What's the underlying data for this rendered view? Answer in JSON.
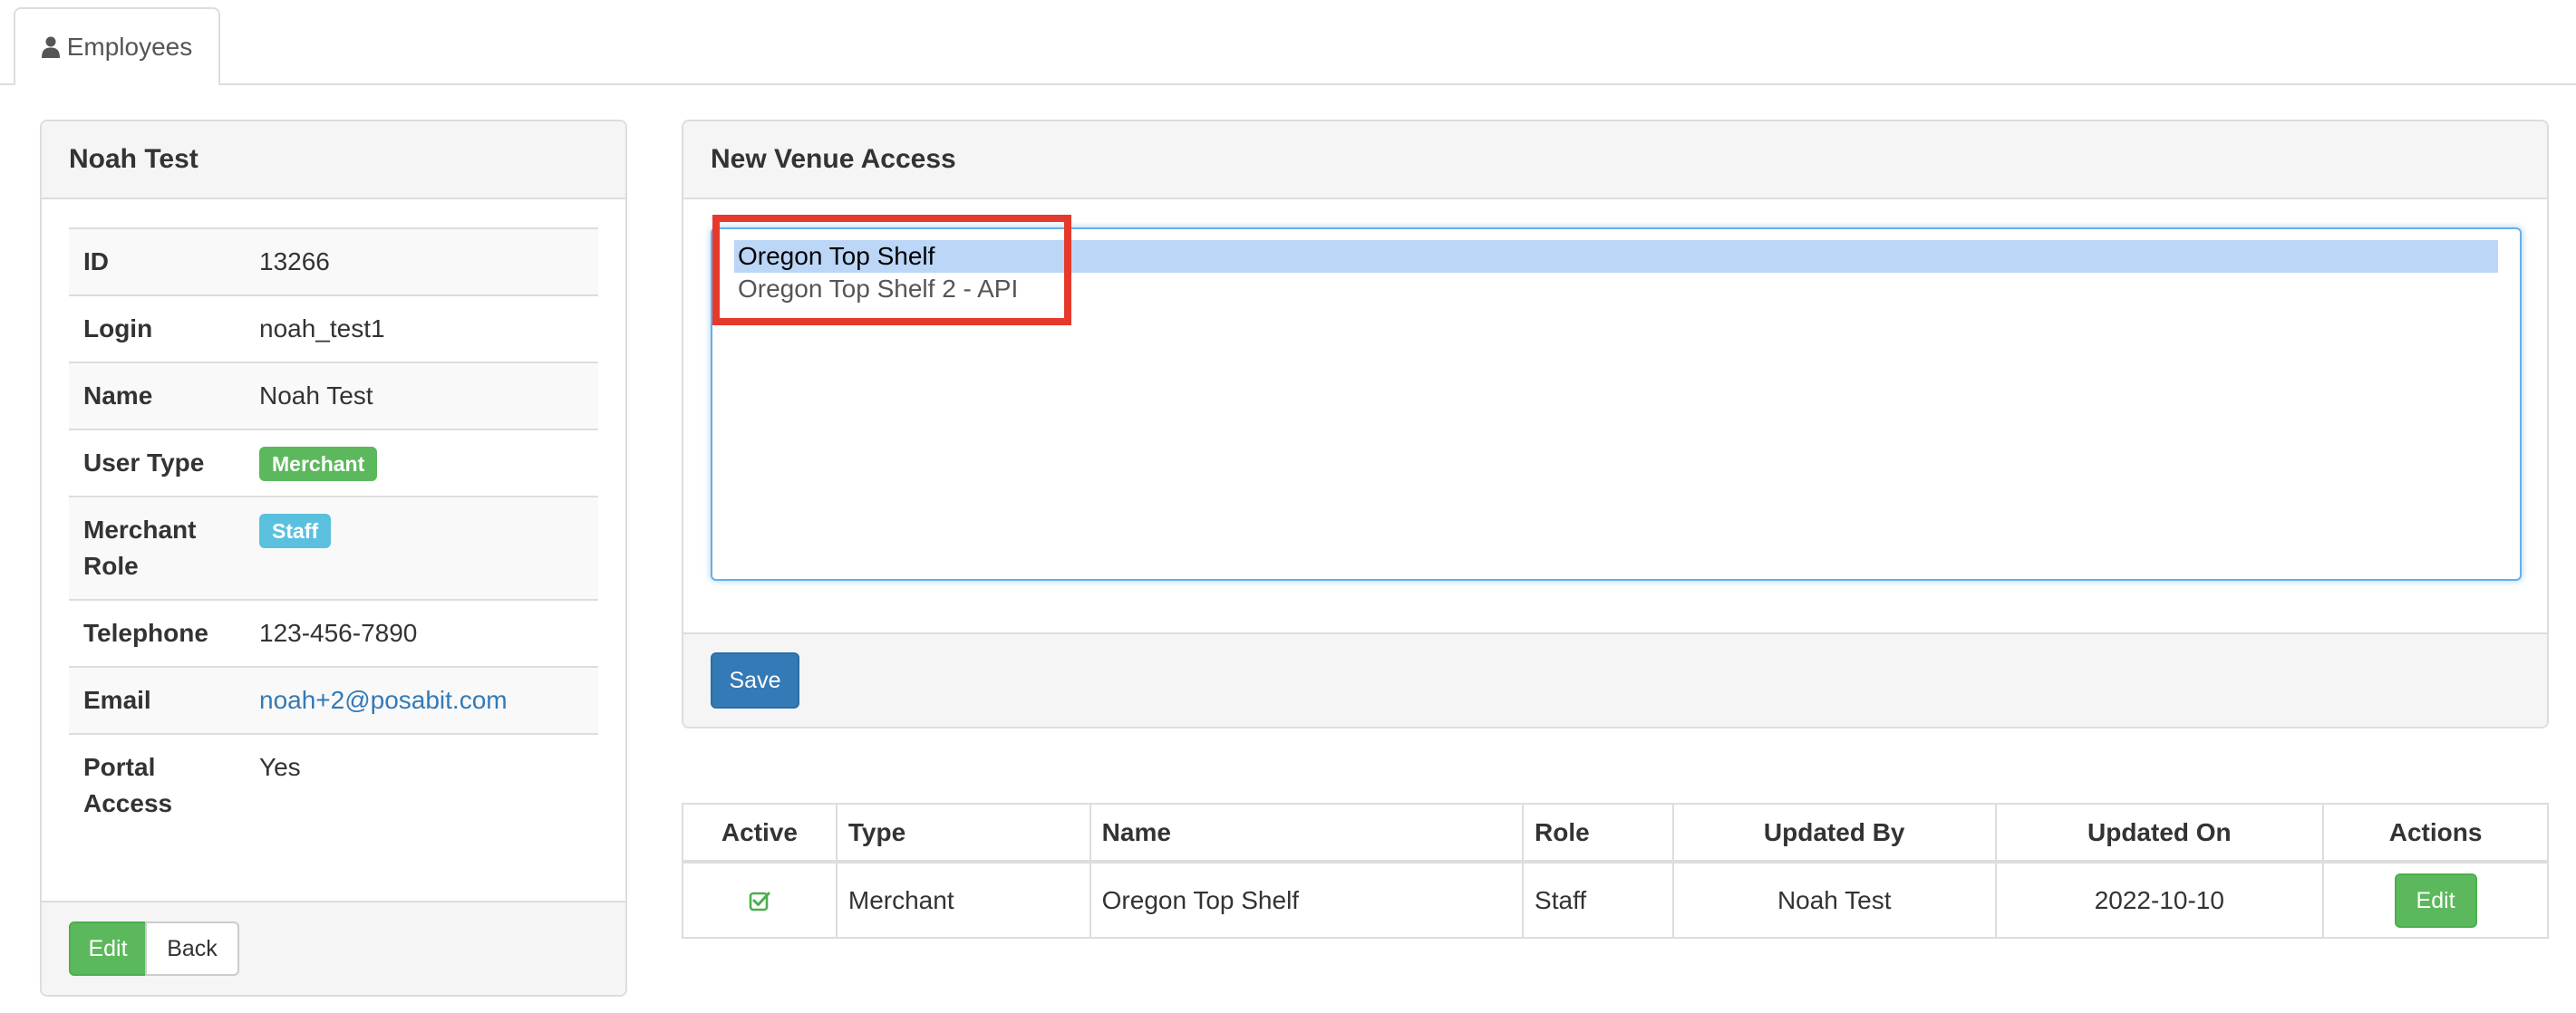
{
  "tabs": [
    {
      "label": "Employees",
      "icon": "user-icon"
    }
  ],
  "employee_panel": {
    "title": "Noah Test",
    "fields": [
      {
        "label": "ID",
        "value": "13266"
      },
      {
        "label": "Login",
        "value": "noah_test1"
      },
      {
        "label": "Name",
        "value": "Noah Test"
      },
      {
        "label": "User Type",
        "value": "Merchant",
        "badge_color": "#5cb85c"
      },
      {
        "label": "Merchant Role",
        "value": "Staff",
        "badge_color": "#5bc0de"
      },
      {
        "label": "Telephone",
        "value": "123-456-7890"
      },
      {
        "label": "Email",
        "value": "noah+2@posabit.com"
      },
      {
        "label": "Portal Access",
        "value": "Yes"
      }
    ],
    "edit_label": "Edit",
    "back_label": "Back"
  },
  "venue_access": {
    "title": "New Venue Access",
    "options": [
      {
        "label": "Oregon Top Shelf",
        "selected": true
      },
      {
        "label": "Oregon Top Shelf 2 - API",
        "selected": false
      }
    ],
    "save_label": "Save"
  },
  "access_table": {
    "columns": [
      "Active",
      "Type",
      "Name",
      "Role",
      "Updated By",
      "Updated On",
      "Actions"
    ],
    "rows": [
      {
        "active": true,
        "type": "Merchant",
        "name": "Oregon Top Shelf",
        "role": "Staff",
        "updated_by": "Noah Test",
        "updated_on": "2022-10-10",
        "action_label": "Edit"
      }
    ]
  },
  "colors": {
    "primary": "#337ab7",
    "success": "#5cb85c",
    "info": "#5bc0de",
    "annotation": "#e53a2b"
  }
}
